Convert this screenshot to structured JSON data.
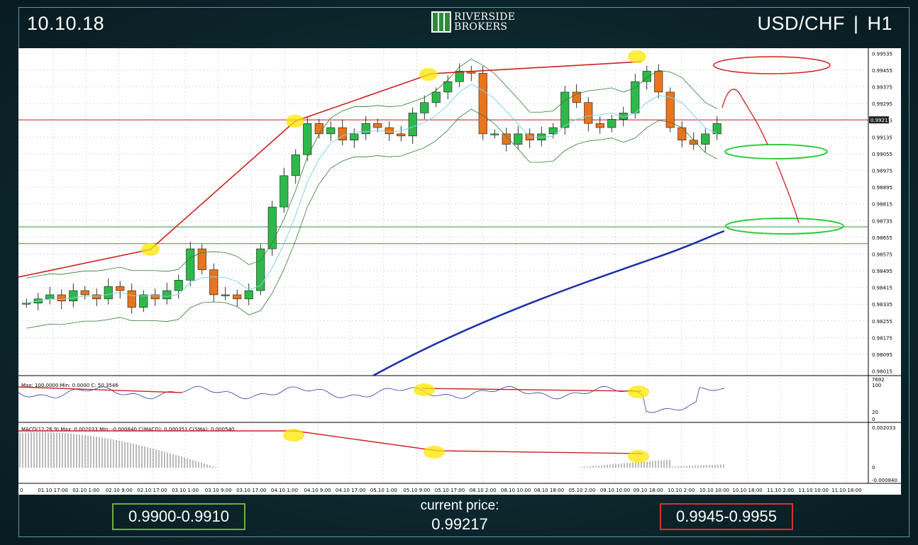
{
  "header": {
    "date": "10.10.18",
    "pair": "USD/CHF",
    "separator": "|",
    "timeframe": "H1",
    "brand_line1": "RIVERSIDE",
    "brand_line2": "BROKERS"
  },
  "footer": {
    "support_range": "0.9900-0.9910",
    "current_price_label": "current price:",
    "current_price": "0.99217",
    "resistance_range": "0.9945-0.9955"
  },
  "colors": {
    "support": "#6fae3c",
    "resistance": "#d93030",
    "bull_candle": "#2fb84a",
    "bear_candle": "#e8741e",
    "ma200": "#1a2fa8",
    "bollinger": "#2e7d32",
    "ema_fast": "#7fd4e8",
    "highlight": "#ffe600"
  },
  "chart_data": {
    "type": "candlestick",
    "price_axis": {
      "ylim": [
        0.98,
        0.9956
      ],
      "ticks": [
        "0.99535",
        "0.99455",
        "0.99375",
        "0.99295",
        "0.99215",
        "0.99135",
        "0.99055",
        "0.98975",
        "0.98895",
        "0.98815",
        "0.98735",
        "0.98655",
        "0.98575",
        "0.98495",
        "0.98415",
        "0.98335",
        "0.98255",
        "0.98175",
        "0.98095",
        "0.98015"
      ],
      "current_price_tag": "0.99217"
    },
    "time_axis": {
      "ticks": [
        "0",
        "01.10 17:00",
        "02.10 1:00",
        "02.10 9:00",
        "02.10 17:00",
        "03.10 1:00",
        "03.10 9:00",
        "03.10 17:00",
        "04.10 1:00",
        "04.10 9:00",
        "04.10 17:00",
        "05.10 1:00",
        "05.10 9:00",
        "05.10 17:00",
        "08.10 2:00",
        "08.10 10:00",
        "08.10 18:00",
        "05.10 2:00",
        "09.10 10:00",
        "09.10 18:00",
        "10.10 2:00",
        "10.10 10:00",
        "10.10 18:00",
        "11.10 2:00",
        "11.10 10:00",
        "11.10 18:00"
      ]
    },
    "close_path": [
      0.9834,
      0.9836,
      0.9838,
      0.9835,
      0.984,
      0.9838,
      0.9836,
      0.9842,
      0.984,
      0.9832,
      0.9838,
      0.9836,
      0.984,
      0.9845,
      0.986,
      0.985,
      0.9838,
      0.9838,
      0.9836,
      0.984,
      0.986,
      0.988,
      0.9895,
      0.9905,
      0.992,
      0.9915,
      0.9918,
      0.9912,
      0.9915,
      0.992,
      0.9918,
      0.9915,
      0.9914,
      0.9925,
      0.993,
      0.9935,
      0.994,
      0.9945,
      0.9944,
      0.9915,
      0.9915,
      0.991,
      0.9915,
      0.9912,
      0.9915,
      0.9918,
      0.9935,
      0.993,
      0.992,
      0.9918,
      0.9922,
      0.9925,
      0.994,
      0.9945,
      0.9935,
      0.9918,
      0.9912,
      0.991,
      0.9915,
      0.992
    ],
    "indicators": {
      "stochastic": {
        "label": "Max: 100.0000  Min: 0.0000  C: 50.3546",
        "axis_ticks": [
          "100",
          "20",
          "0"
        ],
        "scale_label": "7692"
      },
      "macd": {
        "label": "MACD(12,26,9)  Max: 0.002033  Min: -0.000840  C(MACD): 0.000351  C(SMA): 0.000540",
        "axis_ticks": [
          "0.002033",
          "0",
          "-0.000840"
        ]
      }
    }
  }
}
